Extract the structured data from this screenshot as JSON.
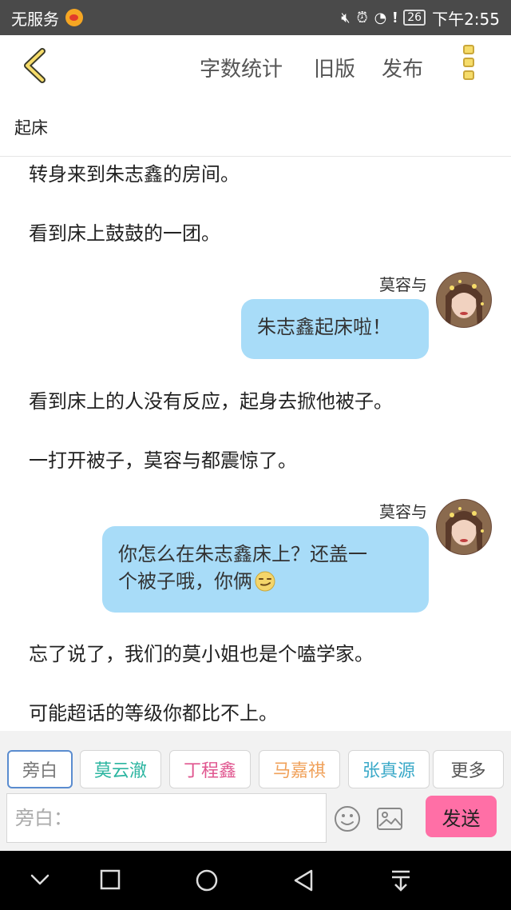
{
  "status_bar": {
    "carrier": "无服务",
    "battery": "26",
    "time": "下午2:55"
  },
  "header": {
    "nav": [
      "字数统计",
      "旧版",
      "发布"
    ]
  },
  "title": "起床",
  "content": {
    "items": [
      {
        "type": "narration",
        "text": "转身来到朱志鑫的房间。"
      },
      {
        "type": "narration",
        "text": "看到床上鼓鼓的一团。"
      },
      {
        "type": "dialogue",
        "speaker": "莫容与",
        "lines": [
          "朱志鑫起床啦！"
        ]
      },
      {
        "type": "narration",
        "text": "看到床上的人没有反应，起身去掀他被子。"
      },
      {
        "type": "narration",
        "text": "一打开被子，莫容与都震惊了。"
      },
      {
        "type": "dialogue",
        "speaker": "莫容与",
        "lines": [
          "你怎么在朱志鑫床上？还盖一",
          "个被子哦，你俩"
        ],
        "emoji": "smirk-emoji"
      },
      {
        "type": "narration",
        "text": "忘了说了，我们的莫小姐也是个嗑学家。"
      },
      {
        "type": "narration",
        "text": "可能超话的等级你都比不上。"
      }
    ]
  },
  "characters": [
    {
      "name": "旁白",
      "color": "#777777"
    },
    {
      "name": "莫云澈",
      "color": "#2bb5a0"
    },
    {
      "name": "丁程鑫",
      "color": "#e0568f"
    },
    {
      "name": "马嘉祺",
      "color": "#f0a15a"
    },
    {
      "name": "张真源",
      "color": "#3aa9c8"
    },
    {
      "name": "更多",
      "color": "#555555"
    }
  ],
  "input": {
    "placeholder": "旁白："
  },
  "send_label": "发送",
  "icons": {
    "back": "chevron-left-icon",
    "more": "vertical-dots-icon",
    "emoji": "smiley-icon",
    "image": "image-icon"
  },
  "colors": {
    "bubble": "#a8dcf8",
    "send": "#ff6fa6",
    "accent_yellow": "#f6dc6a"
  }
}
